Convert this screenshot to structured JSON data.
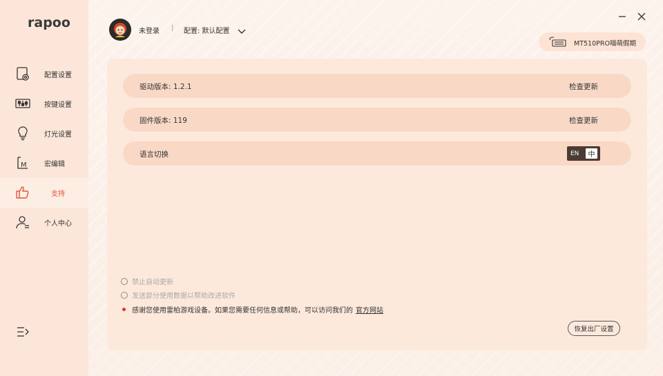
{
  "app": {
    "logo_text": "rapoo"
  },
  "sidebar": {
    "items": [
      {
        "label": "配置设置",
        "icon": "settings-profile-icon",
        "active": false
      },
      {
        "label": "按键设置",
        "icon": "keys-slider-icon",
        "active": false
      },
      {
        "label": "灯光设置",
        "icon": "bulb-icon",
        "active": false
      },
      {
        "label": "宏编辑",
        "icon": "macro-icon",
        "active": false
      },
      {
        "label": "支持",
        "icon": "thumbs-up-icon",
        "active": true
      },
      {
        "label": "个人中心",
        "icon": "user-icon",
        "active": false
      }
    ],
    "collapse_icon": "collapse-menu-icon"
  },
  "header": {
    "user_status": "未登录",
    "separator": "|",
    "profile_label": "配置: 默认配置",
    "device_name": "MT510PRO喵萌假期"
  },
  "support": {
    "driver_version_label": "驱动版本: 1.2.1",
    "driver_check_label": "检查更新",
    "firmware_version_label": "固件版本:  119",
    "firmware_check_label": "检查更新",
    "language_label": "语言切换",
    "lang_en": "EN",
    "lang_zh": "中"
  },
  "options": {
    "disable_auto_update": "禁止自动更新",
    "send_usage_data": "发送部分使用数据以帮助改进软件",
    "notice_text": "感谢您使用雷柏游戏设备。如果您需要任何信息或帮助，可以访问我们的",
    "notice_link": "官方网站"
  },
  "footer": {
    "reset_label": "恢复出厂设置"
  },
  "colors": {
    "accent": "#e0563a",
    "sidebar_bg": "#fbe6d9",
    "panel_bg": "#fde9dc",
    "row_bg": "#f9d9c6",
    "toggle_bg": "#4a3b33"
  }
}
